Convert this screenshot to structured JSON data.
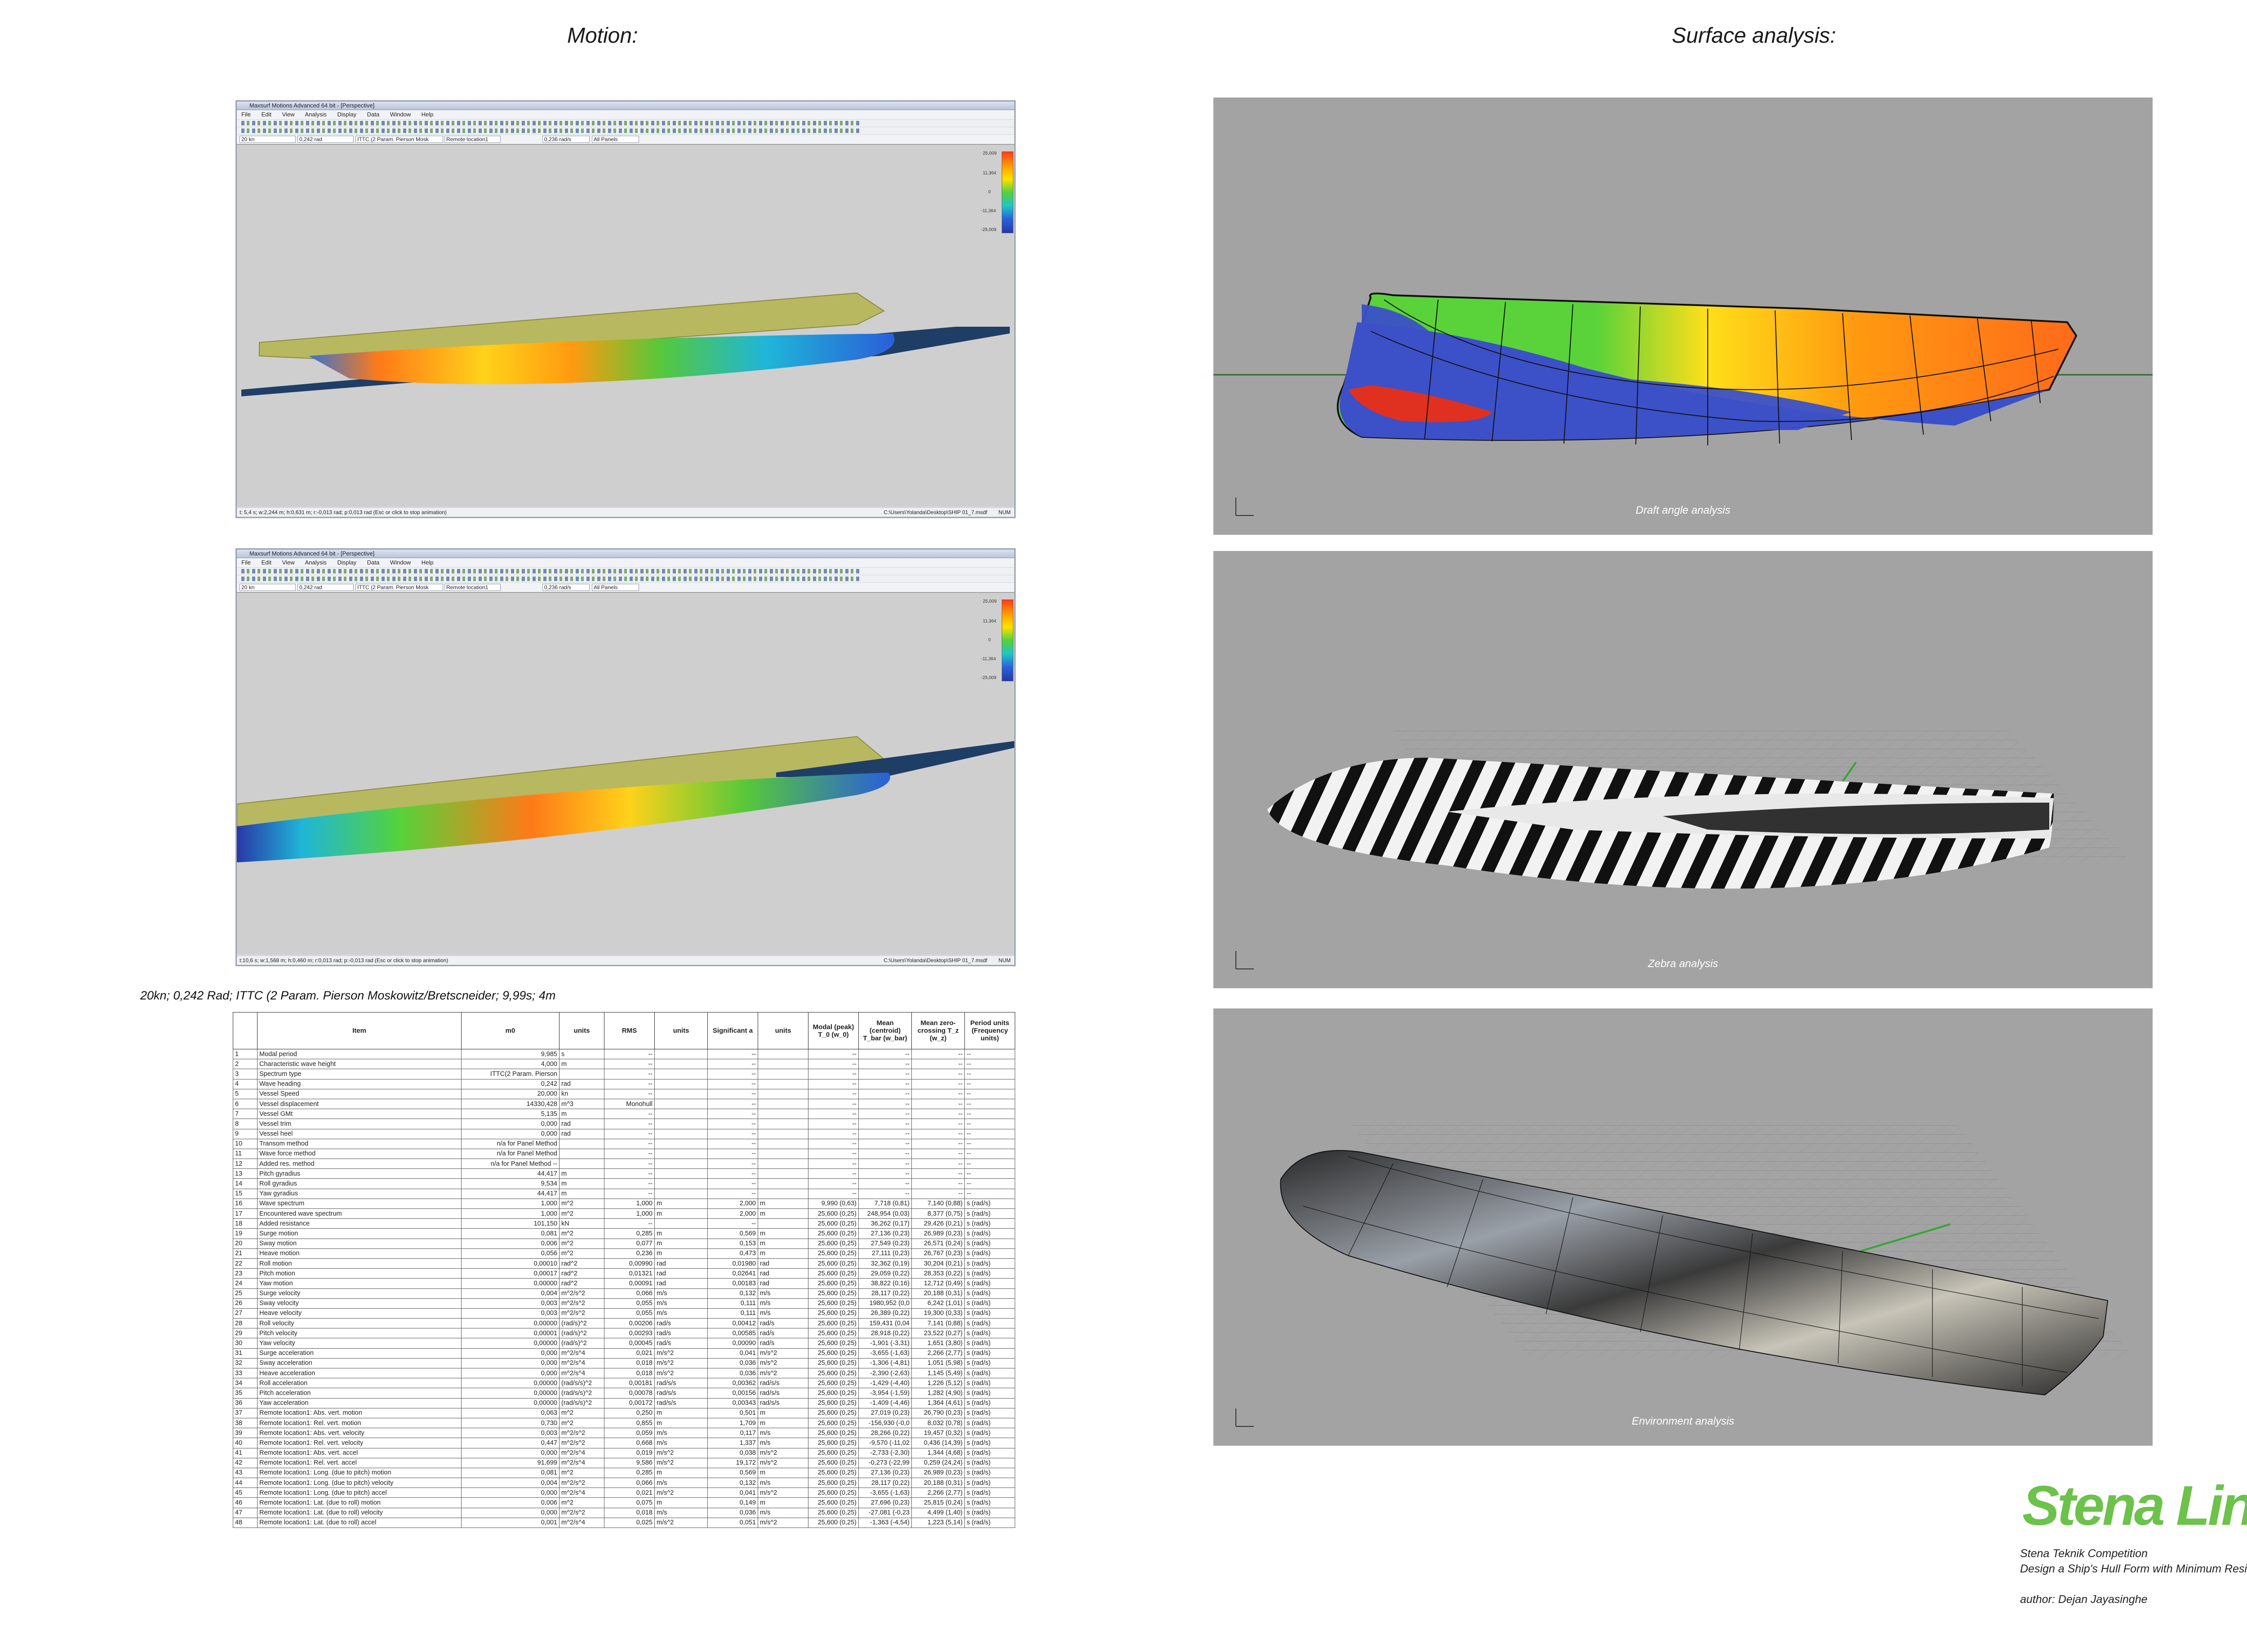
{
  "headings": {
    "motion": "Motion:",
    "surface": "Surface analysis:"
  },
  "app": {
    "window_title": "Maxsurf Motions Advanced 64 bit - [Perspective]",
    "menu": [
      "File",
      "Edit",
      "View",
      "Analysis",
      "Display",
      "Data",
      "Window",
      "Help"
    ],
    "combos": [
      "20 kn",
      "0,242 rad",
      "ITTC (2 Param. Pierson Mosk",
      "Remote location1",
      "0,236 rad/s",
      "All Panels"
    ],
    "colorbar_labels_top": [
      "25,009",
      "11,364",
      "0",
      "-11,364",
      "-25,009"
    ],
    "status_path": "C:\\Users\\Yolanda\\Desktop\\SHIP 01_7.msdf",
    "status_num": "NUM",
    "status_top": "t: 5,4 s; w:2,244 m; h:0,631 m; r:-0,013 rad; p:0,013 rad (Esc or click to stop animation)",
    "status_bottom": "t:10,6 s; w:1,568 m; h:0,460 m; r:0,013 rad; p:-0,013 rad (Esc or click to stop animation)",
    "colormap": [
      "#ff3a1a",
      "#ff9a00",
      "#ffe100",
      "#56d23a",
      "#1fc6c8",
      "#2a5fd8",
      "#2838a8"
    ]
  },
  "panels": {
    "draft": "Draft angle analysis",
    "zebra": "Zebra analysis",
    "environment": "Environment analysis"
  },
  "table_caption": "20kn; 0,242 Rad; ITTC (2 Param. Pierson Moskowitz/Bretscneider; 9,99s; 4m",
  "table_headers": [
    "",
    "Item",
    "m0",
    "units",
    "RMS",
    "units",
    "Significant a",
    "units",
    "Modal (peak) T_0 (w_0)",
    "Mean (centroid) T_bar (w_bar)",
    "Mean zero-crossing T_z (w_z)",
    "Period units (Frequency units)"
  ],
  "table_rows": [
    [
      "1",
      "Modal period",
      "9,985",
      "s",
      "--",
      "",
      "--",
      "",
      "--",
      "--",
      "--",
      "--"
    ],
    [
      "2",
      "Characteristic wave height",
      "4,000",
      "m",
      "--",
      "",
      "--",
      "",
      "--",
      "--",
      "--",
      "--"
    ],
    [
      "3",
      "Spectrum type",
      "ITTC(2 Param. Pierson",
      "",
      "--",
      "",
      "--",
      "",
      "--",
      "--",
      "--",
      "--"
    ],
    [
      "4",
      "Wave heading",
      "0,242",
      "rad",
      "--",
      "",
      "--",
      "",
      "--",
      "--",
      "--",
      "--"
    ],
    [
      "5",
      "Vessel Speed",
      "20,000",
      "kn",
      "--",
      "",
      "--",
      "",
      "--",
      "--",
      "--",
      "--"
    ],
    [
      "6",
      "Vessel displacement",
      "14330,428",
      "m^3",
      "Monohull",
      "",
      "--",
      "",
      "--",
      "--",
      "--",
      "--"
    ],
    [
      "7",
      "Vessel GMt",
      "5,135",
      "m",
      "--",
      "",
      "--",
      "",
      "--",
      "--",
      "--",
      "--"
    ],
    [
      "8",
      "Vessel trim",
      "0,000",
      "rad",
      "--",
      "",
      "--",
      "",
      "--",
      "--",
      "--",
      "--"
    ],
    [
      "9",
      "Vessel heel",
      "0,000",
      "rad",
      "--",
      "",
      "--",
      "",
      "--",
      "--",
      "--",
      "--"
    ],
    [
      "10",
      "Transom method",
      "n/a for Panel Method",
      "",
      "--",
      "",
      "--",
      "",
      "--",
      "--",
      "--",
      "--"
    ],
    [
      "11",
      "Wave force method",
      "n/a for Panel Method",
      "",
      "--",
      "",
      "--",
      "",
      "--",
      "--",
      "--",
      "--"
    ],
    [
      "12",
      "Added res. method",
      "n/a for Panel Method --",
      "",
      "--",
      "",
      "--",
      "",
      "--",
      "--",
      "--",
      "--"
    ],
    [
      "13",
      "Pitch gyradius",
      "44,417",
      "m",
      "--",
      "",
      "--",
      "",
      "--",
      "--",
      "--",
      "--"
    ],
    [
      "14",
      "Roll gyradius",
      "9,534",
      "m",
      "--",
      "",
      "--",
      "",
      "--",
      "--",
      "--",
      "--"
    ],
    [
      "15",
      "Yaw gyradius",
      "44,417",
      "m",
      "--",
      "",
      "--",
      "",
      "--",
      "--",
      "--",
      "--"
    ],
    [
      "16",
      "Wave spectrum",
      "1,000",
      "m^2",
      "1,000",
      "m",
      "2,000",
      "m",
      "9,990 (0,63)",
      "7,718 (0,81)",
      "7,140 (0,88)",
      "s (rad/s)"
    ],
    [
      "17",
      "Encountered wave spectrum",
      "1,000",
      "m^2",
      "1,000",
      "m",
      "2,000",
      "m",
      "25,600 (0,25)",
      "248,954 (0,03)",
      "8,377 (0,75)",
      "s (rad/s)"
    ],
    [
      "18",
      "Added resistance",
      "101,150",
      "kN",
      "--",
      "",
      "--",
      "",
      "25,600 (0,25)",
      "36,262 (0,17)",
      "29,426 (0,21)",
      "s (rad/s)"
    ],
    [
      "19",
      "Surge motion",
      "0,081",
      "m^2",
      "0,285",
      "m",
      "0,569",
      "m",
      "25,600 (0,25)",
      "27,136 (0,23)",
      "26,989 (0,23)",
      "s (rad/s)"
    ],
    [
      "20",
      "Sway motion",
      "0,006",
      "m^2",
      "0,077",
      "m",
      "0,153",
      "m",
      "25,600 (0,25)",
      "27,549 (0,23)",
      "26,571 (0,24)",
      "s (rad/s)"
    ],
    [
      "21",
      "Heave motion",
      "0,056",
      "m^2",
      "0,236",
      "m",
      "0,473",
      "m",
      "25,600 (0,25)",
      "27,111 (0,23)",
      "26,767 (0,23)",
      "s (rad/s)"
    ],
    [
      "22",
      "Roll motion",
      "0,00010",
      "rad^2",
      "0,00990",
      "rad",
      "0,01980",
      "rad",
      "25,600 (0,25)",
      "32,362 (0,19)",
      "30,204 (0,21)",
      "s (rad/s)"
    ],
    [
      "23",
      "Pitch motion",
      "0,00017",
      "rad^2",
      "0,01321",
      "rad",
      "0,02641",
      "rad",
      "25,600 (0,25)",
      "29,059 (0,22)",
      "28,353 (0,22)",
      "s (rad/s)"
    ],
    [
      "24",
      "Yaw motion",
      "0,00000",
      "rad^2",
      "0,00091",
      "rad",
      "0,00183",
      "rad",
      "25,600 (0,25)",
      "38,822 (0,16)",
      "12,712 (0,49)",
      "s (rad/s)"
    ],
    [
      "25",
      "Surge velocity",
      "0,004",
      "m^2/s^2",
      "0,066",
      "m/s",
      "0,132",
      "m/s",
      "25,600 (0,25)",
      "28,117 (0,22)",
      "20,188 (0,31)",
      "s (rad/s)"
    ],
    [
      "26",
      "Sway velocity",
      "0,003",
      "m^2/s^2",
      "0,055",
      "m/s",
      "0,111",
      "m/s",
      "25,600 (0,25)",
      "1980,952 (0,0",
      "6,242 (1,01)",
      "s (rad/s)"
    ],
    [
      "27",
      "Heave velocity",
      "0,003",
      "m^2/s^2",
      "0,055",
      "m/s",
      "0,111",
      "m/s",
      "25,600 (0,25)",
      "26,389 (0,22)",
      "19,300 (0,33)",
      "s (rad/s)"
    ],
    [
      "28",
      "Roll velocity",
      "0,00000",
      "(rad/s)^2",
      "0,00206",
      "rad/s",
      "0,00412",
      "rad/s",
      "25,600 (0,25)",
      "159,431 (0,04",
      "7,141 (0,88)",
      "s (rad/s)"
    ],
    [
      "29",
      "Pitch velocity",
      "0,00001",
      "(rad/s)^2",
      "0,00293",
      "rad/s",
      "0,00585",
      "rad/s",
      "25,600 (0,25)",
      "28,918 (0,22)",
      "23,522 (0,27)",
      "s (rad/s)"
    ],
    [
      "30",
      "Yaw velocity",
      "0,00000",
      "(rad/s)^2",
      "0,00045",
      "rad/s",
      "0,00090",
      "rad/s",
      "25,600 (0,25)",
      "-1,901 (-3,31)",
      "1,651 (3,80)",
      "s (rad/s)"
    ],
    [
      "31",
      "Surge acceleration",
      "0,000",
      "m^2/s^4",
      "0,021",
      "m/s^2",
      "0,041",
      "m/s^2",
      "25,600 (0,25)",
      "-3,655 (-1,63)",
      "2,266 (2,77)",
      "s (rad/s)"
    ],
    [
      "32",
      "Sway acceleration",
      "0,000",
      "m^2/s^4",
      "0,018",
      "m/s^2",
      "0,036",
      "m/s^2",
      "25,600 (0,25)",
      "-1,306 (-4,81)",
      "1,051 (5,98)",
      "s (rad/s)"
    ],
    [
      "33",
      "Heave acceleration",
      "0,000",
      "m^2/s^4",
      "0,018",
      "m/s^2",
      "0,036",
      "m/s^2",
      "25,600 (0,25)",
      "-2,390 (-2,63)",
      "1,145 (5,49)",
      "s (rad/s)"
    ],
    [
      "34",
      "Roll acceleration",
      "0,00000",
      "(rad/s/s)^2",
      "0,00181",
      "rad/s/s",
      "0,00362",
      "rad/s/s",
      "25,600 (0,25)",
      "-1,429 (-4,40)",
      "1,226 (5,12)",
      "s (rad/s)"
    ],
    [
      "35",
      "Pitch acceleration",
      "0,00000",
      "(rad/s/s)^2",
      "0,00078",
      "rad/s/s",
      "0,00156",
      "rad/s/s",
      "25,600 (0,25)",
      "-3,954 (-1,59)",
      "1,282 (4,90)",
      "s (rad/s)"
    ],
    [
      "36",
      "Yaw acceleration",
      "0,00000",
      "(rad/s/s)^2",
      "0,00172",
      "rad/s/s",
      "0,00343",
      "rad/s/s",
      "25,600 (0,25)",
      "-1,409 (-4,46)",
      "1,364 (4,61)",
      "s (rad/s)"
    ],
    [
      "37",
      "Remote location1: Abs. vert. motion",
      "0,063",
      "m^2",
      "0,250",
      "m",
      "0,501",
      "m",
      "25,600 (0,25)",
      "27,019 (0,23)",
      "26,790 (0,23)",
      "s (rad/s)"
    ],
    [
      "38",
      "Remote location1: Rel. vert. motion",
      "0,730",
      "m^2",
      "0,855",
      "m",
      "1,709",
      "m",
      "25,600 (0,25)",
      "-156,930 (-0,0",
      "8,032 (0,78)",
      "s (rad/s)"
    ],
    [
      "39",
      "Remote location1: Abs. vert. velocity",
      "0,003",
      "m^2/s^2",
      "0,059",
      "m/s",
      "0,117",
      "m/s",
      "25,600 (0,25)",
      "28,266 (0,22)",
      "19,457 (0,32)",
      "s (rad/s)"
    ],
    [
      "40",
      "Remote location1: Rel. vert. velocity",
      "0,447",
      "m^2/s^2",
      "0,668",
      "m/s",
      "1,337",
      "m/s",
      "25,600 (0,25)",
      "-9,570 (-11,02",
      "0,436 (14,39)",
      "s (rad/s)"
    ],
    [
      "41",
      "Remote location1: Abs. vert. accel",
      "0,000",
      "m^2/s^4",
      "0,019",
      "m/s^2",
      "0,038",
      "m/s^2",
      "25,600 (0,25)",
      "-2,733 (-2,30)",
      "1,344 (4,68)",
      "s (rad/s)"
    ],
    [
      "42",
      "Remote location1: Rel. vert. accel",
      "91,699",
      "m^2/s^4",
      "9,586",
      "m/s^2",
      "19,172",
      "m/s^2",
      "25,600 (0,25)",
      "-0,273 (-22,99",
      "0,259 (24,24)",
      "s (rad/s)"
    ],
    [
      "43",
      "Remote location1: Long. (due to pitch) motion",
      "0,081",
      "m^2",
      "0,285",
      "m",
      "0,569",
      "m",
      "25,600 (0,25)",
      "27,136 (0,23)",
      "26,989 (0,23)",
      "s (rad/s)"
    ],
    [
      "44",
      "Remote location1: Long. (due to pitch) velocity",
      "0,004",
      "m^2/s^2",
      "0,066",
      "m/s",
      "0,132",
      "m/s",
      "25,600 (0,25)",
      "28,117 (0,22)",
      "20,188 (0,31)",
      "s (rad/s)"
    ],
    [
      "45",
      "Remote location1: Long. (due to pitch) accel",
      "0,000",
      "m^2/s^4",
      "0,021",
      "m/s^2",
      "0,041",
      "m/s^2",
      "25,600 (0,25)",
      "-3,655 (-1,63)",
      "2,266 (2,77)",
      "s (rad/s)"
    ],
    [
      "46",
      "Remote location1: Lat. (due to roll) motion",
      "0,006",
      "m^2",
      "0,075",
      "m",
      "0,149",
      "m",
      "25,600 (0,25)",
      "27,696 (0,23)",
      "25,815 (0,24)",
      "s (rad/s)"
    ],
    [
      "47",
      "Remote location1: Lat. (due to roll) velocity",
      "0,000",
      "m^2/s^2",
      "0,018",
      "m/s",
      "0,036",
      "m/s",
      "25,600 (0,25)",
      "-27,081 (-0,23",
      "4,499 (1,40)",
      "s (rad/s)"
    ],
    [
      "48",
      "Remote location1: Lat. (due to roll) accel",
      "0,001",
      "m^2/s^4",
      "0,025",
      "m/s^2",
      "0,051",
      "m/s^2",
      "25,600 (0,25)",
      "-1,363 (-4,54)",
      "1,223 (5,14)",
      "s (rad/s)"
    ]
  ],
  "brand": {
    "logo": "Stena Line",
    "line1": "Stena Teknik Competition",
    "line2": "Design a Ship's Hull Form with Minimum Resistance",
    "author": "author: Dejan Jayasinghe",
    "logo_color": "#6cc24a"
  },
  "icons": [
    "hull-render",
    "axis-triad-icon",
    "colorbar-legend"
  ]
}
